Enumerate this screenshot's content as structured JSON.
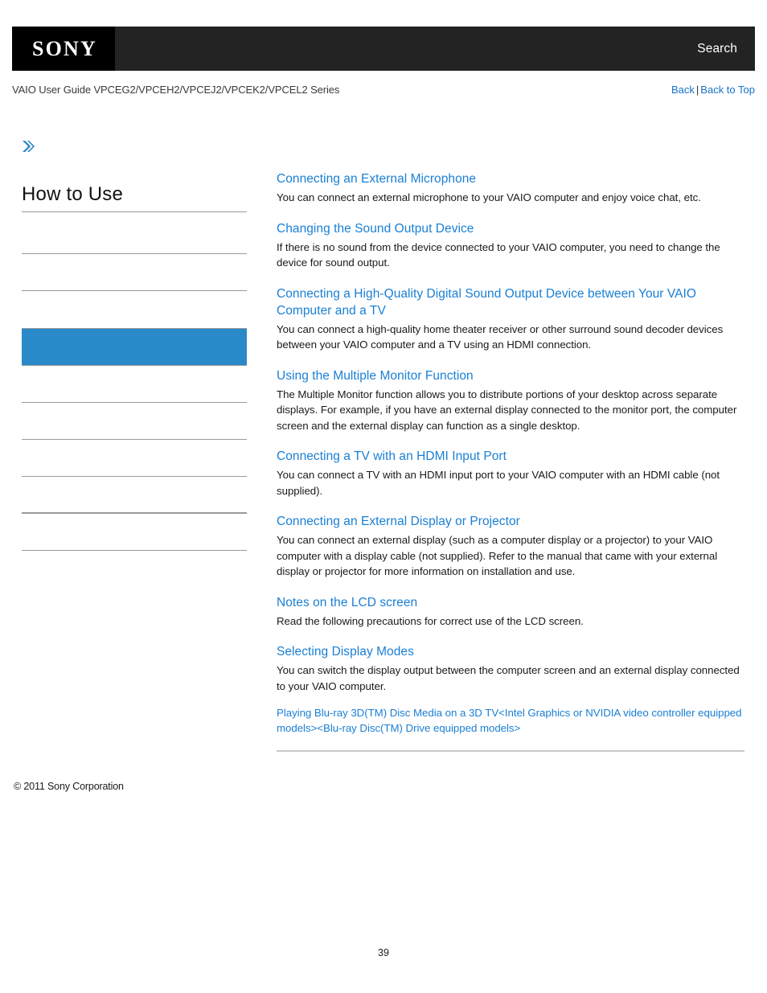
{
  "header": {
    "logo": "SONY",
    "search_label": "Search",
    "brand_black": "#000000",
    "bar_black": "#232323"
  },
  "subheader": {
    "title": "VAIO User Guide VPCEG2/VPCEH2/VPCEJ2/VPCEK2/VPCEL2 Series",
    "back_label": "Back",
    "separator": "|",
    "back_to_top_label": "Back to Top",
    "link_color": "#1572c8"
  },
  "sidebar": {
    "chevron_icon": "double-chevron-right",
    "title": "How to Use",
    "selected_color": "#2a89c8",
    "items": [
      {
        "label": "",
        "selected": false
      },
      {
        "label": "",
        "selected": false
      },
      {
        "label": "",
        "selected": false
      },
      {
        "label": "",
        "selected": true
      },
      {
        "label": "",
        "selected": false
      },
      {
        "label": "",
        "selected": false
      },
      {
        "label": "",
        "selected": false
      },
      {
        "label": "",
        "selected": false
      },
      {
        "label": "",
        "selected": false
      },
      {
        "label": "",
        "selected": false
      }
    ]
  },
  "main": {
    "link_color": "#1a7fd4",
    "entries": [
      {
        "title": "Connecting an External Microphone",
        "description": "You can connect an external microphone to your VAIO computer and enjoy voice chat, etc."
      },
      {
        "title": "Changing the Sound Output Device",
        "description": "If there is no sound from the device connected to your VAIO computer, you need to change the device for sound output."
      },
      {
        "title": "Connecting a High-Quality Digital Sound Output Device between Your VAIO Computer and a TV",
        "description": "You can connect a high-quality home theater receiver or other surround sound decoder devices between your VAIO computer and a TV using an HDMI connection."
      },
      {
        "title": "Using the Multiple Monitor Function",
        "description": "The Multiple Monitor function allows you to distribute portions of your desktop across separate displays. For example, if you have an external display connected to the monitor port, the computer screen and the external display can function as a single desktop."
      },
      {
        "title": "Connecting a TV with an HDMI Input Port",
        "description": "You can connect a TV with an HDMI input port to your VAIO computer with an HDMI cable (not supplied)."
      },
      {
        "title": "Connecting an External Display or Projector",
        "description": "You can connect an external display (such as a computer display or a projector) to your VAIO computer with a display cable (not supplied). Refer to the manual that came with your external display or projector for more information on installation and use."
      },
      {
        "title": "Notes on the LCD screen",
        "description": "Read the following precautions for correct use of the LCD screen."
      },
      {
        "title": "Selecting Display Modes",
        "description": "You can switch the display output between the computer screen and an external display connected to your VAIO computer."
      }
    ],
    "extra_link": "Playing Blu-ray 3D(TM) Disc Media on a 3D TV<Intel Graphics or NVIDIA video controller equipped models><Blu-ray Disc(TM) Drive equipped models>"
  },
  "footer": {
    "copyright": "© 2011 Sony Corporation",
    "page_number": "39"
  }
}
